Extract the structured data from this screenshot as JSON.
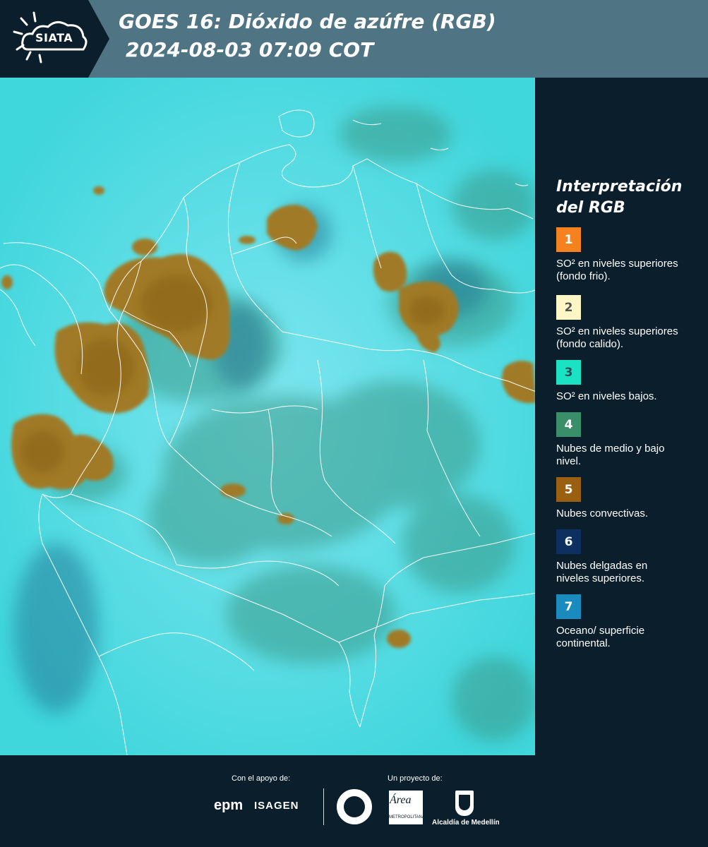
{
  "header": {
    "logo_text": "SIATA",
    "title": "GOES 16: Dióxido de azúfre (RGB)",
    "subtitle": "2024-08-03 07:09 COT"
  },
  "legend": {
    "title_line1": "Interpretación",
    "title_line2": "del RGB",
    "items": [
      {
        "number": "1",
        "color": "#f5821f",
        "text_color": "#ffffff",
        "description": "SO² en niveles superiores (fondo frio)."
      },
      {
        "number": "2",
        "color": "#fdf6c5",
        "text_color": "#555555",
        "description": "SO² en niveles superiores (fondo calido)."
      },
      {
        "number": "3",
        "color": "#19e3c3",
        "text_color": "#2f4e5a",
        "description": "SO² en niveles bajos."
      },
      {
        "number": "4",
        "color": "#3a8f6a",
        "text_color": "#ffffff",
        "description": "Nubes de medio y bajo nivel."
      },
      {
        "number": "5",
        "color": "#9b5f11",
        "text_color": "#ffffff",
        "description": "Nubes convectivas."
      },
      {
        "number": "6",
        "color": "#0e3060",
        "text_color": "#ffffff",
        "description": "Nubes delgadas en niveles superiores."
      },
      {
        "number": "7",
        "color": "#1a8bbf",
        "text_color": "#ffffff",
        "description": "Oceano/ superficie continental."
      }
    ]
  },
  "footer": {
    "support_label": "Con el apoyo de:",
    "project_label": "Un proyecto de:",
    "epm": "epm",
    "isagen": "ISAGEN",
    "area_logo": "Área",
    "area_sub": "METROPOLITANA Valle de Aburrá",
    "alcaldia": "Alcaldía de Medellín"
  },
  "colors": {
    "header_bg": "#4f7585",
    "panel_bg": "#0b1e2c",
    "map_base": "#3fd6dc",
    "convective_cloud": "#a07a25",
    "mid_low_cloud": "#3c9a86"
  }
}
